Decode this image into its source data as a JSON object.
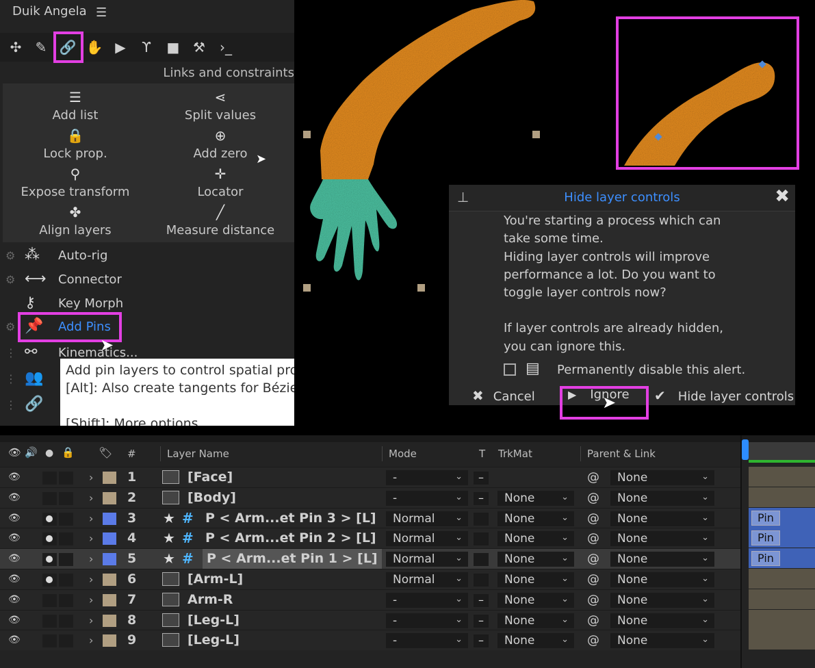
{
  "duik": {
    "title": "Duik Angela",
    "menu_icon": "hamburger-icon",
    "toolbar_icons": [
      "bone-icon",
      "brush-icon",
      "link-icon",
      "hand-icon",
      "play-icon",
      "branch-icon",
      "camera-icon",
      "tool-icon",
      "terminal-icon"
    ],
    "section_title": "Links and constraints",
    "grid_items": [
      {
        "icon": "list-icon",
        "label": "Add list"
      },
      {
        "icon": "split-icon",
        "label": "Split values"
      },
      {
        "icon": "lock-icon",
        "label": "Lock prop."
      },
      {
        "icon": "add-zero-icon",
        "label": "Add zero"
      },
      {
        "icon": "compass-icon",
        "label": "Expose transform"
      },
      {
        "icon": "locator-icon",
        "label": "Locator"
      },
      {
        "icon": "align-icon",
        "label": "Align layers"
      },
      {
        "icon": "ruler-icon",
        "label": "Measure distance"
      }
    ],
    "list_items": [
      {
        "icon": "wand-icon",
        "label": "Auto-rig"
      },
      {
        "icon": "connector-icon",
        "label": "Connector"
      },
      {
        "icon": "keymorph-icon",
        "label": "Key Morph"
      },
      {
        "icon": "pin-icon",
        "label": "Add Pins"
      },
      {
        "icon": "kinematics-icon",
        "label": "Kinematics..."
      },
      {
        "icon": "people-icon",
        "label": ""
      },
      {
        "icon": "chain-icon",
        "label": ""
      }
    ],
    "tooltip": {
      "line1": "Add pin layers to control spatial pro",
      "line2": "[Alt]: Also create tangents for Bézie",
      "line3": "[Shift]: More options"
    }
  },
  "dialog": {
    "title": "Hide layer controls",
    "line1": "You're starting a process which can",
    "line2": "take some time.",
    "line3": "Hiding layer controls will improve",
    "line4": "performance a lot. Do you want to",
    "line5": "toggle layer controls now?",
    "line6": "If layer controls are already hidden,",
    "line7": "you can ignore this.",
    "checkbox_label": "Permanently disable this alert.",
    "cancel_label": "Cancel",
    "ignore_label": "Ignore",
    "hide_label": "Hide layer controls"
  },
  "timeline": {
    "headers": {
      "num": "#",
      "name": "Layer Name",
      "mode": "Mode",
      "t": "T",
      "trkmat": "TrkMat",
      "parent": "Parent & Link"
    },
    "pin_label": "Pin",
    "layers": [
      {
        "num": "1",
        "name": "[Face]",
        "mode": "-",
        "trkmat": "",
        "parent": "None"
      },
      {
        "num": "2",
        "name": "[Body]",
        "mode": "-",
        "trkmat": "None",
        "parent": "None"
      },
      {
        "num": "3",
        "name": "P < Arm...et Pin 3 > [L]",
        "mode": "Normal",
        "trkmat": "None",
        "parent": "None"
      },
      {
        "num": "4",
        "name": "P < Arm...et Pin 2 > [L]",
        "mode": "Normal",
        "trkmat": "None",
        "parent": "None"
      },
      {
        "num": "5",
        "name": "P < Arm...et Pin 1 > [L]",
        "mode": "Normal",
        "trkmat": "None",
        "parent": "None"
      },
      {
        "num": "6",
        "name": "[Arm-L]",
        "mode": "Normal",
        "trkmat": "None",
        "parent": "None"
      },
      {
        "num": "7",
        "name": "Arm-R",
        "mode": "-",
        "trkmat": "None",
        "parent": "None"
      },
      {
        "num": "8",
        "name": "[Leg-L]",
        "mode": "-",
        "trkmat": "None",
        "parent": "None"
      },
      {
        "num": "9",
        "name": "[Leg-L]",
        "mode": "-",
        "trkmat": "None",
        "parent": "None"
      }
    ]
  },
  "colors": {
    "highlight": "#e23fe2",
    "accent": "#3d8fff",
    "arm": "#e28a1e",
    "hand": "#4bbf9f",
    "pin_bar": "#3f62b7",
    "label_tan": "#b19f82",
    "label_blue": "#5b7be8"
  }
}
